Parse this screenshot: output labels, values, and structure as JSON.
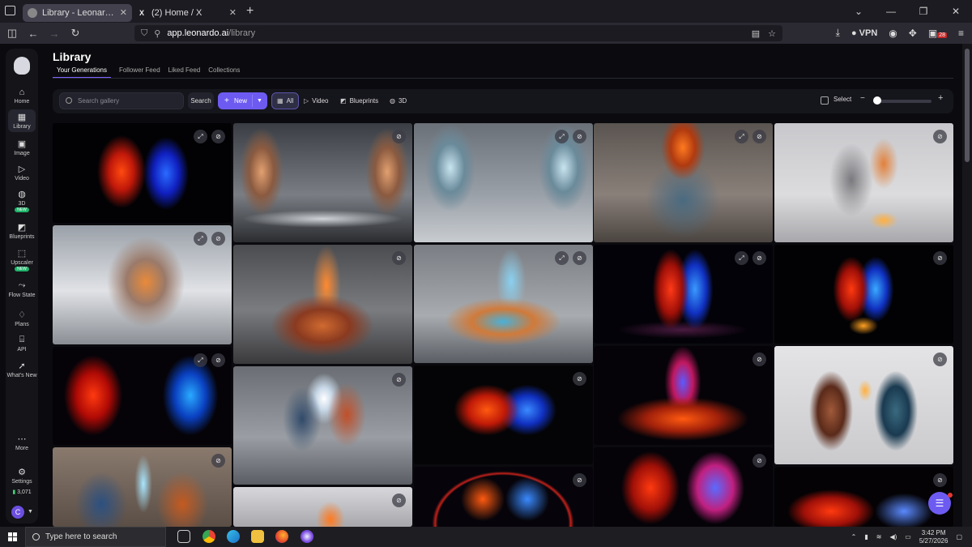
{
  "browser": {
    "tabs": [
      {
        "title": "Library - Leonardo.Ai App - Generate",
        "active": true
      },
      {
        "title": "(2) Home / X",
        "active": false
      }
    ],
    "url_host": "app.leonardo.ai",
    "url_path": "/library",
    "vpn_label": "VPN",
    "ext_badge": "28"
  },
  "sidebar": {
    "items": [
      {
        "label": "Home",
        "icon": "home-icon",
        "glyph": "⌂"
      },
      {
        "label": "Library",
        "icon": "library-icon",
        "glyph": "▦",
        "active": true
      },
      {
        "label": "Image",
        "icon": "image-icon",
        "glyph": "▣"
      },
      {
        "label": "Video",
        "icon": "video-icon",
        "glyph": "▷"
      },
      {
        "label": "3D",
        "icon": "globe-icon",
        "glyph": "◍",
        "badge": "NEW"
      },
      {
        "label": "Blueprints",
        "icon": "blueprint-icon",
        "glyph": "◩"
      },
      {
        "label": "Upscaler",
        "icon": "upscaler-icon",
        "glyph": "⬚",
        "badge": "NEW"
      },
      {
        "label": "Flow State",
        "icon": "flow-icon",
        "glyph": "⤳"
      },
      {
        "label": "Plans",
        "icon": "diamond-icon",
        "glyph": "♢"
      },
      {
        "label": "API",
        "icon": "api-icon",
        "glyph": "⌸"
      },
      {
        "label": "What's New",
        "icon": "rocket-icon",
        "glyph": "➚"
      }
    ],
    "more_label": "More",
    "settings_label": "Settings",
    "credits": "3,071",
    "avatar_letter": "C"
  },
  "header": {
    "title": "Library",
    "tabs": [
      "Your Generations",
      "Follower Feed",
      "Liked Feed",
      "Collections"
    ]
  },
  "toolbar": {
    "search_placeholder": "Search gallery",
    "search_label": "Search",
    "new_label": "New",
    "filters": [
      {
        "label": "All",
        "glyph": "▦",
        "active": true
      },
      {
        "label": "Video",
        "glyph": "▷"
      },
      {
        "label": "Blueprints",
        "glyph": "◩"
      },
      {
        "label": "3D",
        "glyph": "◍"
      }
    ],
    "select_label": "Select",
    "zoom_level": 0.1
  },
  "taskbar": {
    "search_placeholder": "Type here to search",
    "time": "3:42 PM",
    "date": "5/27/2026"
  },
  "colors": {
    "accent": "#6d5bf1",
    "new_badge": "#20b46a",
    "background": "#0b0b0f"
  }
}
